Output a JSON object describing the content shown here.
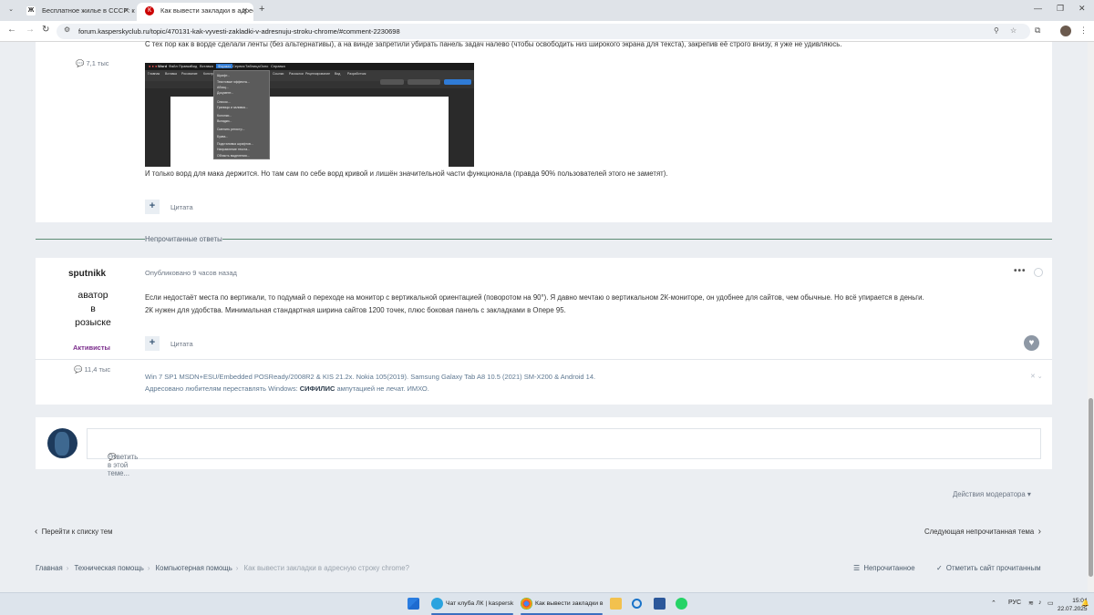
{
  "browser": {
    "tabs": [
      {
        "title": "Бесплатное жилье в СССР: ко",
        "active": false
      },
      {
        "title": "Как вывести закладки в адрес",
        "active": true
      }
    ],
    "url": "forum.kasperskyclub.ru/topic/470131-kak-vyvesti-zakladki-v-adresnuju-stroku-chrome/#comment-2230698"
  },
  "post1": {
    "top_text": "С тех пор как в ворде сделали ленты (без альтернативы), а на винде запретили убирать панель задач налево (чтобы освободить низ широкого экрана для текста), закрепив её строго внизу, я уже не удивляюсь.",
    "author_posts": "7,1 тыс",
    "body_text": "И только ворд для мака держится. Но там сам по себе ворд кривой и лишён значительной части функционала (правда 90% пользователей этого не заметят).",
    "quote_label": "Цитата",
    "screenshot": {
      "menubar": [
        "Word",
        "Файл",
        "Правка",
        "Вид",
        "Вставка",
        "Формат",
        "Сервис",
        "Таблица",
        "Окно",
        "Справка"
      ],
      "ribbon_tabs": [
        "Главная",
        "Вставка",
        "Рисование",
        "Конструктор",
        "Макет",
        "Ссылки",
        "Рассылки",
        "Рецензирование",
        "Вид",
        "Разработчик"
      ],
      "menu_items": [
        "Шрифт...",
        "Текстовые эффекты...",
        "Абзац...",
        "Документ...",
        "Список...",
        "Границы и заливка...",
        "Колонки...",
        "Вкладки...",
        "Сменить регистр...",
        "Буква...",
        "Подстановка шрифтов...",
        "Направление текста...",
        "Область выделения..."
      ]
    }
  },
  "divider": {
    "label": "Непрочитанные ответы"
  },
  "post2": {
    "username": "sputnikk",
    "avatar_text": [
      "аватор",
      "в",
      "розыске"
    ],
    "role": "Активисты",
    "author_posts": "11,4 тыс",
    "published": "Опубликовано 9 часов назад",
    "body_line1": "Если недостаёт места по вертикали, то подумай о переходе на монитор с вертикальной ориентацией (поворотом на 90°). Я давно мечтаю о вертикальном 2К-мониторе, он удобнее для сайтов, чем обычные. Но всё упирается в деньги.",
    "body_line2": "2К нужен для удобства. Минимальная стандартная ширина сайтов 1200 точек, плюс боковая панель с закладками в Опере 95.",
    "quote_label": "Цитата",
    "signature_line1": "Win 7 SP1 MSDN+ESU/Embedded POSReady/2008R2 & KIS 21.2x. Nokia 105(2019). Samsung Galaxy Tab A8 10.5 (2021) SM-X200 & Android 14.",
    "signature_line2_pre": "Адресовано любителям переставлять Windows: ",
    "signature_line2_bold": "СИФИЛИС",
    "signature_line2_post": " ампутацией не лечат. ИМХО."
  },
  "reply": {
    "placeholder": "Ответить в этой теме..."
  },
  "moderator_actions": "Действия модератора",
  "nav": {
    "back": "Перейти к списку тем",
    "next": "Следующая непрочитанная тема"
  },
  "breadcrumb": [
    "Главная",
    "Техническая помощь",
    "Компьютерная помощь",
    "Как вывести закладки в адресную строку chrome?"
  ],
  "footer_links": {
    "unread": "Непрочитанное",
    "mark_read": "Отметить сайт прочитанным"
  },
  "taskbar": {
    "items": [
      {
        "label": "Чат клуба ЛК | kaspersk"
      },
      {
        "label": "Как вывести закладки в"
      }
    ],
    "lang": "РУС",
    "time": "15:04",
    "date": "22.07.2025"
  },
  "colors": {
    "accent": "#5d8c74",
    "role": "#7b2d8c",
    "link": "#5e7891"
  }
}
